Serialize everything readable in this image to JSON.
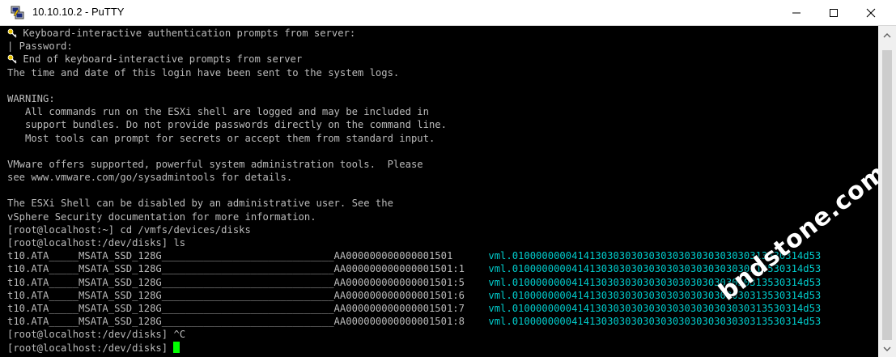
{
  "window": {
    "title": "10.10.10.2 - PuTTY",
    "accent": "#00ff00",
    "link_color": "#00cccc"
  },
  "controls": {
    "minimize": "minimize-icon",
    "maximize": "maximize-icon",
    "close": "close-icon"
  },
  "terminal": {
    "lines": [
      "Keyboard-interactive authentication prompts from server:",
      "| Password:",
      "End of keyboard-interactive prompts from server",
      "The time and date of this login have been sent to the system logs.",
      "",
      "WARNING:",
      "   All commands run on the ESXi shell are logged and may be included in",
      "   support bundles. Do not provide passwords directly on the command line.",
      "   Most tools can prompt for secrets or accept them from standard input.",
      "",
      "VMware offers supported, powerful system administration tools.  Please",
      "see www.vmware.com/go/sysadmintools for details.",
      "",
      "The ESXi Shell can be disabled by an administrative user. See the",
      "vSphere Security documentation for more information.",
      "[root@localhost:~] cd /vmfs/devices/disks",
      "[root@localhost:/dev/disks] ls"
    ],
    "listing": [
      {
        "name": "t10.ATA_____MSATA_SSD_128G_____________________________AA000000000000001501  ",
        "vml": "vml.0100000000414130303030303030303030303030313530314d53"
      },
      {
        "name": "t10.ATA_____MSATA_SSD_128G_____________________________AA000000000000001501:1",
        "vml": "vml.0100000000414130303030303030303030303030313530314d53"
      },
      {
        "name": "t10.ATA_____MSATA_SSD_128G_____________________________AA000000000000001501:5",
        "vml": "vml.0100000000414130303030303030303030303030313530314d53"
      },
      {
        "name": "t10.ATA_____MSATA_SSD_128G_____________________________AA000000000000001501:6",
        "vml": "vml.0100000000414130303030303030303030303030313530314d53"
      },
      {
        "name": "t10.ATA_____MSATA_SSD_128G_____________________________AA000000000000001501:7",
        "vml": "vml.0100000000414130303030303030303030303030313530314d53"
      },
      {
        "name": "t10.ATA_____MSATA_SSD_128G_____________________________AA000000000000001501:8",
        "vml": "vml.0100000000414130303030303030303030303030313530314d53"
      }
    ],
    "after": [
      "[root@localhost:/dev/disks] ^C",
      "[root@localhost:/dev/disks] "
    ]
  },
  "watermark": "bndstone.com"
}
